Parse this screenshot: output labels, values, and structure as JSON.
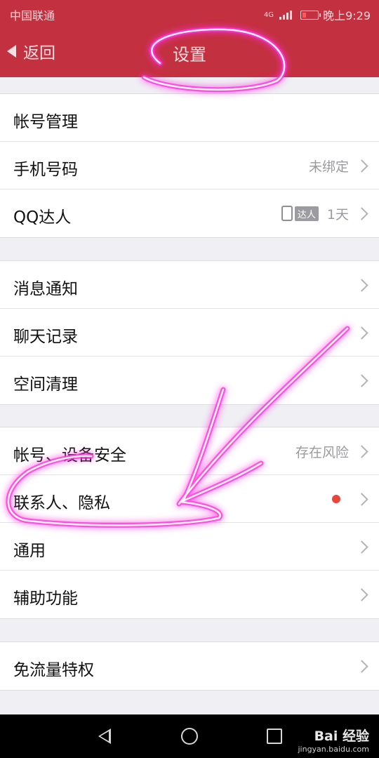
{
  "status_bar": {
    "carrier": "中国联通",
    "network": "4G",
    "time": "晚上9:29"
  },
  "nav": {
    "back_label": "返回",
    "title": "设置"
  },
  "sections": [
    {
      "rows": [
        {
          "label": "帐号管理",
          "value": ""
        },
        {
          "label": "手机号码",
          "value": "未绑定"
        },
        {
          "label": "QQ达人",
          "badge": "达人",
          "value": "1天"
        }
      ]
    },
    {
      "rows": [
        {
          "label": "消息通知",
          "value": ""
        },
        {
          "label": "聊天记录",
          "value": ""
        },
        {
          "label": "空间清理",
          "value": ""
        }
      ]
    },
    {
      "rows": [
        {
          "label": "帐号、设备安全",
          "value": "存在风险"
        },
        {
          "label": "联系人、隐私",
          "value": ""
        },
        {
          "label": "通用",
          "value": ""
        },
        {
          "label": "辅助功能",
          "value": ""
        }
      ]
    },
    {
      "rows": [
        {
          "label": "免流量特权",
          "value": ""
        }
      ]
    }
  ],
  "watermark": {
    "brand": "Bai 经验",
    "url": "jingyan.baidu.com"
  },
  "colors": {
    "header": "#c3303f",
    "background": "#efeff4",
    "annotation": "#ff33dd",
    "alert_dot": "#e8453c"
  }
}
